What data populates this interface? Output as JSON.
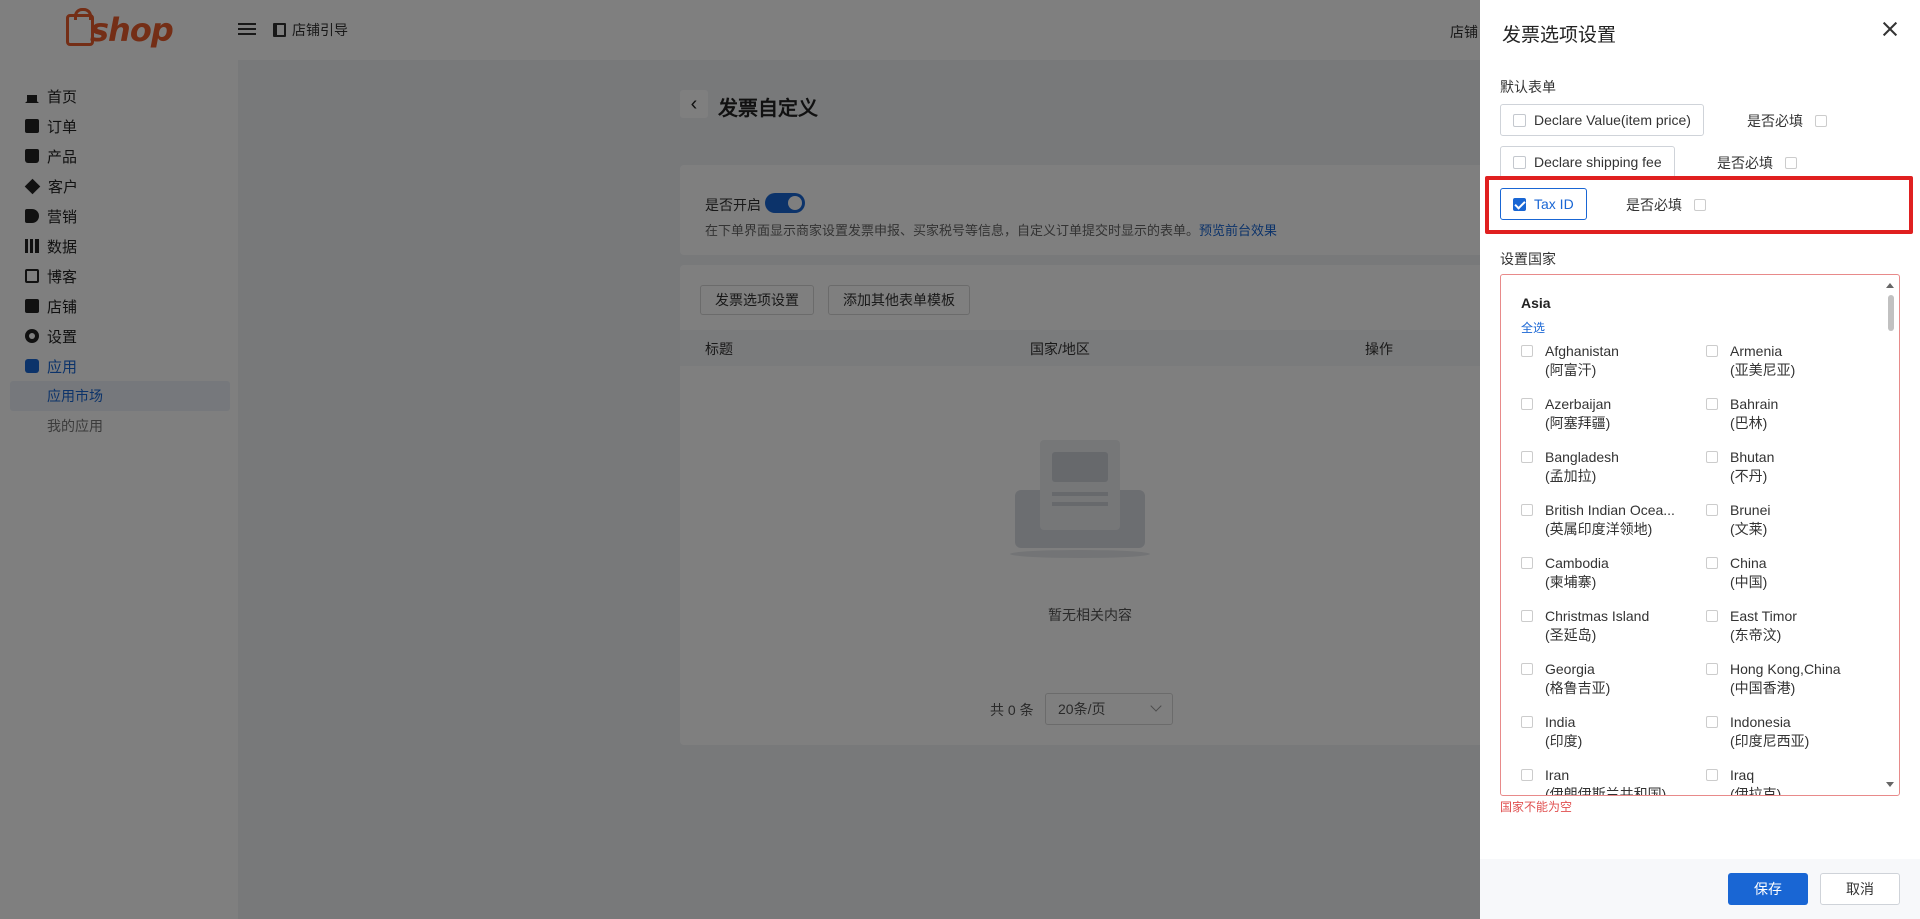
{
  "header": {
    "logo_text": "shop",
    "store_guide": "店铺引导",
    "right_text": "店铺"
  },
  "sidebar": {
    "items": [
      {
        "label": "首页",
        "icon": "home-icon"
      },
      {
        "label": "订单",
        "icon": "clipboard-icon"
      },
      {
        "label": "产品",
        "icon": "bag-icon"
      },
      {
        "label": "客户",
        "icon": "diamond-icon"
      },
      {
        "label": "营销",
        "icon": "tag-icon"
      },
      {
        "label": "数据",
        "icon": "bar-chart-icon"
      },
      {
        "label": "博客",
        "icon": "edit-icon"
      },
      {
        "label": "店铺",
        "icon": "store-icon"
      },
      {
        "label": "设置",
        "icon": "gear-icon"
      },
      {
        "label": "应用",
        "icon": "puzzle-icon"
      }
    ],
    "sub_items": [
      {
        "label": "应用市场"
      },
      {
        "label": "我的应用"
      }
    ],
    "active_color": "#1966d4"
  },
  "main": {
    "title": "发票自定义",
    "enable_label": "是否开启",
    "enable_desc": "在下单界面显示商家设置发票申报、买家税号等信息，自定义订单提交时显示的表单。",
    "preview_link": "预览前台效果",
    "buttons": {
      "invoice_settings": "发票选项设置",
      "add_template": "添加其他表单模板"
    },
    "table_headers": [
      "标题",
      "国家/地区",
      "操作"
    ],
    "empty_text": "暂无相关内容",
    "pager_total": "共 0 条",
    "pager_size": "20条/页"
  },
  "drawer": {
    "title": "发票选项设置",
    "default_form_label": "默认表单",
    "required_label": "是否必填",
    "fields": [
      {
        "label": "Declare Value(item price)",
        "checked": false,
        "required": false
      },
      {
        "label": "Declare shipping fee",
        "checked": false,
        "required": false
      },
      {
        "label": "Tax ID",
        "checked": true,
        "required": false
      }
    ],
    "country_label": "设置国家",
    "region": "Asia",
    "select_all": "全选",
    "countries": [
      {
        "en": "Afghanistan",
        "zh": "(阿富汗)"
      },
      {
        "en": "Armenia",
        "zh": "(亚美尼亚)"
      },
      {
        "en": "Azerbaijan",
        "zh": "(阿塞拜疆)"
      },
      {
        "en": "Bahrain",
        "zh": "(巴林)"
      },
      {
        "en": "Bangladesh",
        "zh": "(孟加拉)"
      },
      {
        "en": "Bhutan",
        "zh": "(不丹)"
      },
      {
        "en": "British Indian Ocea...",
        "zh": "(英属印度洋领地)"
      },
      {
        "en": "Brunei",
        "zh": "(文莱)"
      },
      {
        "en": "Cambodia",
        "zh": "(柬埔寨)"
      },
      {
        "en": "China",
        "zh": "(中国)"
      },
      {
        "en": "Christmas Island",
        "zh": "(圣延岛)"
      },
      {
        "en": "East Timor",
        "zh": "(东帝汶)"
      },
      {
        "en": "Georgia",
        "zh": "(格鲁吉亚)"
      },
      {
        "en": "Hong Kong,China",
        "zh": "(中国香港)"
      },
      {
        "en": "India",
        "zh": "(印度)"
      },
      {
        "en": "Indonesia",
        "zh": "(印度尼西亚)"
      },
      {
        "en": "Iran",
        "zh": "(伊朗伊斯兰共和国)"
      },
      {
        "en": "Iraq",
        "zh": "(伊拉克)"
      }
    ],
    "error_text": "国家不能为空",
    "save": "保存",
    "cancel": "取消",
    "highlight_color": "#e02020"
  }
}
